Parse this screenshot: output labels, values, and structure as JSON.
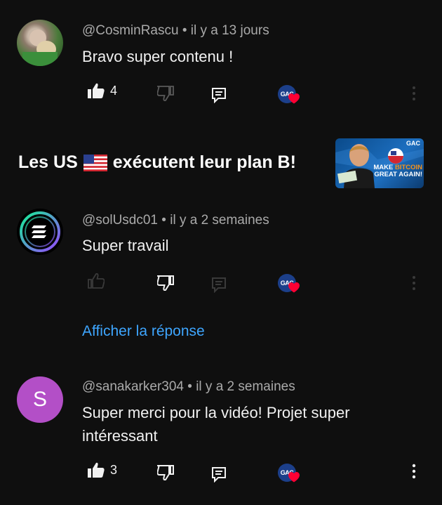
{
  "comments": [
    {
      "author": "@CosminRascu",
      "time": "il y a 13 jours",
      "text": "Bravo super contenu !",
      "likes": "4",
      "avatar_type": "photo"
    },
    {
      "author": "@solUsdc01",
      "time": "il y a 2 semaines",
      "text": "Super travail",
      "likes": "",
      "avatar_type": "solana-logo"
    },
    {
      "author": "@sanakarker304",
      "time": "il y a 2 semaines",
      "text": "Super merci pour la vidéo! Projet super intéressant",
      "likes": "3",
      "avatar_letter": "S",
      "avatar_color": "#b34fc7"
    }
  ],
  "separator": " • ",
  "video": {
    "title_part1": "Les US",
    "title_part2": "exécutent leur plan B!",
    "thumb_brand": "GAC",
    "thumb_line1_a": "MAKE ",
    "thumb_line1_b": "BITCOIN",
    "thumb_line2": "GREAT AGAIN!"
  },
  "creator_badge": "GAC",
  "reply_link": "Afficher la réponse",
  "icons": {
    "like": "thumbs-up-icon",
    "dislike": "thumbs-down-icon",
    "reply": "reply-comment-icon",
    "heart": "creator-heart-icon",
    "more": "more-vertical-icon"
  },
  "colors": {
    "background": "#0f0f0f",
    "link": "#3ea6ff",
    "heart": "#ff0033"
  }
}
